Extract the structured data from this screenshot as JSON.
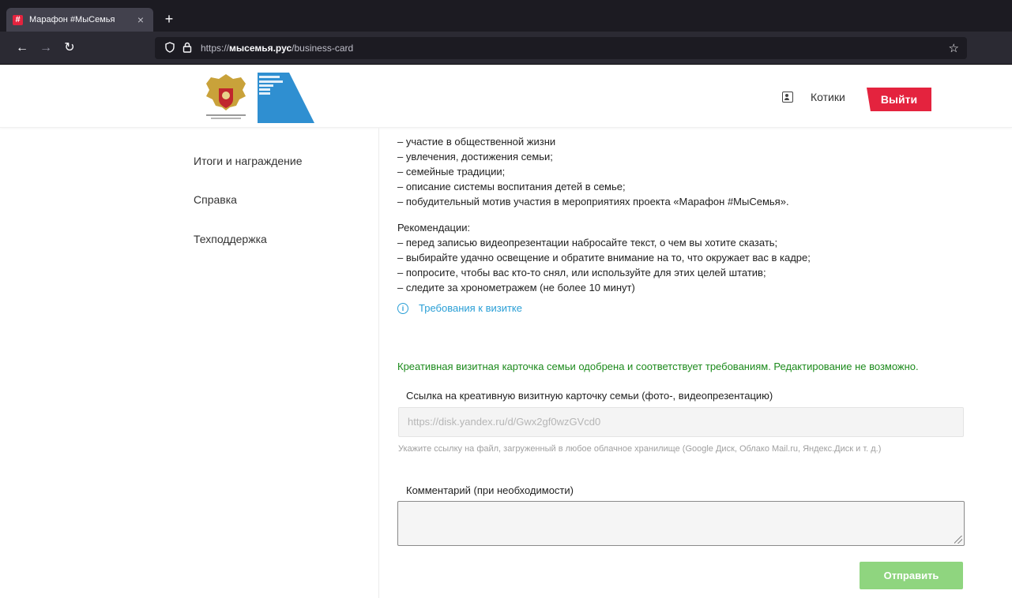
{
  "browser": {
    "tab_title": "Марафон #МыСемья",
    "tab_favicon": "#",
    "tab_close": "×",
    "new_tab": "+",
    "url_prefix": "https://",
    "url_domain": "мысемья.рус",
    "url_path": "/business-card",
    "icons": [
      "back-arrow-icon",
      "forward-arrow-icon",
      "reload-icon",
      "shield-icon",
      "lock-icon",
      "star-icon"
    ]
  },
  "header": {
    "user_name": "Котики",
    "logout_label": "Выйти",
    "accent_color": "#e4233e"
  },
  "sidebar": {
    "items": [
      {
        "label": "Итоги и награждение"
      },
      {
        "label": "Справка"
      },
      {
        "label": "Техподдержка"
      }
    ]
  },
  "content": {
    "lines": [
      "– участие в общественной жизни",
      "– увлечения, достижения семьи;",
      "– семейные традиции;",
      "– описание системы воспитания детей в семье;",
      "– побудительный мотив участия в мероприятиях проекта «Марафон #МыСемья»."
    ],
    "recommendations_title": "Рекомендации:",
    "recommendations": [
      "– перед записью видеопрезентации набросайте текст, о чем вы хотите сказать;",
      "– выбирайте удачно освещение и обратите внимание на то, что окружает вас в кадре;",
      "– попросите, чтобы вас кто-то снял, или используйте для этих целей штатив;",
      "– следите за хронометражем (не более 10 минут)"
    ],
    "requirements_link": "Требования к визитке",
    "approved_message": "Креативная визитная карточка семьи одобрена и соответствует требованиям. Редактирование не возможно.",
    "link_label": "Ссылка на креативную визитную карточку семьи (фото-, видеопрезентацию)",
    "link_value": "https://disk.yandex.ru/d/Gwx2gf0wzGVcd0",
    "link_hint": "Укажите ссылку на файл, загруженный в любое облачное хранилище (Google Диск, Облако Mail.ru, Яндекс.Диск и т. д.)",
    "comment_label": "Комментарий (при необходимости)",
    "comment_value": "",
    "submit_label": "Отправить",
    "approved_color": "#1c8a1c",
    "link_color": "#2a9fd6",
    "submit_color": "#8fd57f"
  }
}
